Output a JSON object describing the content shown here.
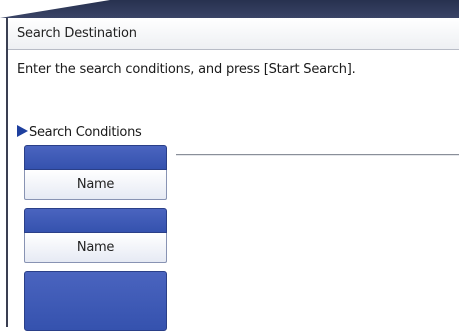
{
  "window": {
    "title": "Search Destination",
    "instruction": "Enter the search conditions, and press [Start Search]."
  },
  "conditions": {
    "section_label": "Search Conditions",
    "items": [
      {
        "button_label": "Name"
      },
      {
        "button_label": "Name"
      }
    ]
  },
  "colors": {
    "accent_blue": "#3a56b4",
    "section_marker": "#1e3f9e",
    "dark_frame": "#2a3354"
  }
}
